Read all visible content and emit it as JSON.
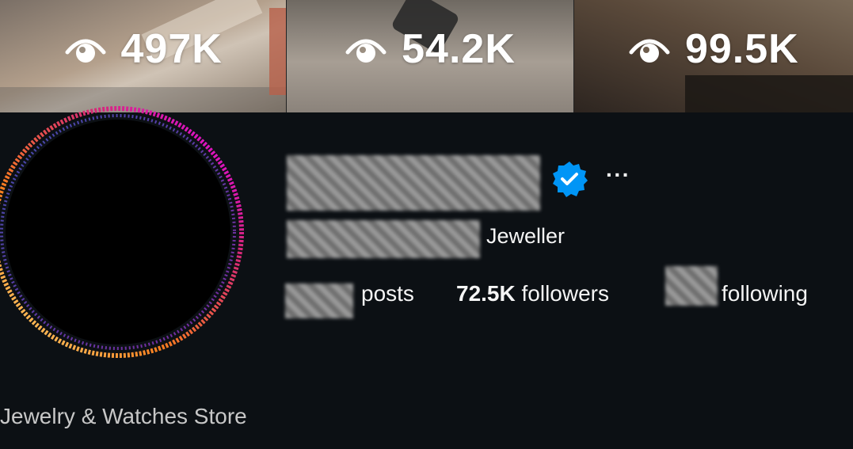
{
  "reels": [
    {
      "views": "497K"
    },
    {
      "views": "54.2K"
    },
    {
      "views": "99.5K"
    }
  ],
  "profile": {
    "category_suffix": "Jeweller",
    "stats": {
      "posts_label": "posts",
      "followers_count": "72.5K",
      "followers_label": "followers",
      "following_label": "following"
    },
    "more_label": "···",
    "bio_category": "Jewelry & Watches Store"
  },
  "colors": {
    "background": "#0c1014",
    "verified_badge": "#0095f6",
    "ring_start": "#feda75",
    "ring_mid": "#fa7e1e",
    "ring_end": "#d62976"
  }
}
